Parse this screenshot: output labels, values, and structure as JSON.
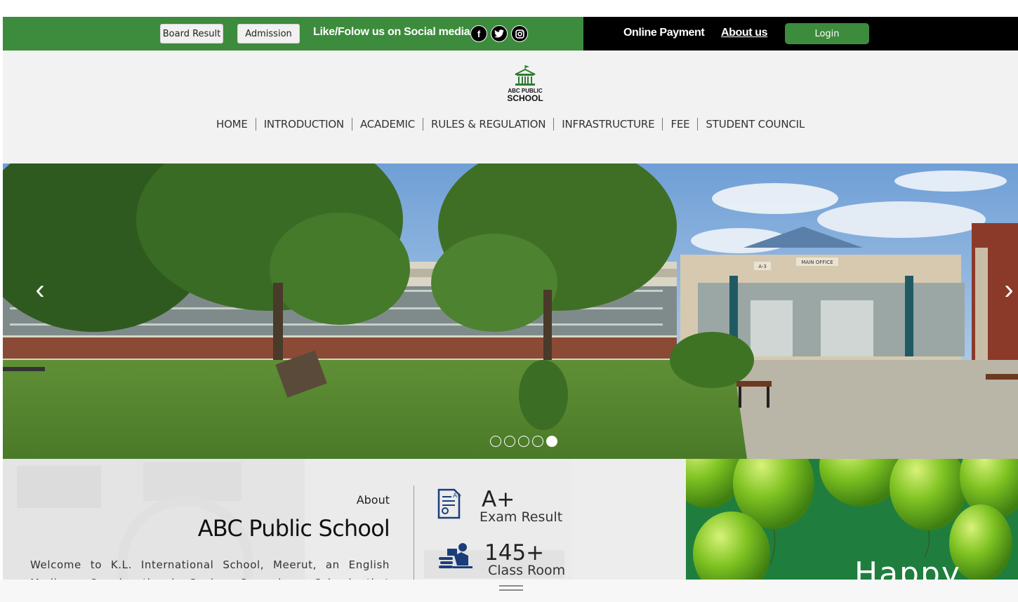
{
  "topbar": {
    "board_result": "Board Result",
    "admission": "Admission",
    "follow_text": "Like/Folow us on Social media",
    "social": [
      {
        "icon": "facebook-icon",
        "glyph": "f"
      },
      {
        "icon": "twitter-icon",
        "glyph": "🐦"
      },
      {
        "icon": "instagram-icon",
        "glyph": "◙"
      }
    ],
    "online_payment": "Online Payment",
    "about_us": "About us",
    "login": "Login",
    "colors": {
      "green": "#3d8b3d",
      "black": "#000000"
    }
  },
  "header": {
    "logo_line1": "ABC PUBLIC",
    "logo_line2": "SCHOOL",
    "nav": [
      "HOME",
      "INTRODUCTION",
      "ACADEMIC",
      "RULES & REGULATION",
      "INFRASTRUCTURE",
      "FEE",
      "STUDENT COUNCIL"
    ]
  },
  "hero": {
    "prev_glyph": "‹",
    "next_glyph": "›",
    "slide_count": 5,
    "active_slide": 5,
    "sign_a3": "A-3",
    "sign_main_office": "MAIN OFFICE"
  },
  "about": {
    "label": "About",
    "title": "ABC Public School",
    "description": "Welcome to K.L. International School, Meerut, an English Medium Co-educational Senior Secondary School that combines the very best in",
    "stats": [
      {
        "value": "A+",
        "label": "Exam Result",
        "icon": "exam-result-icon"
      },
      {
        "value": "145+",
        "label": "Class Room",
        "icon": "classroom-icon"
      }
    ]
  },
  "banner": {
    "text": "Happy"
  }
}
